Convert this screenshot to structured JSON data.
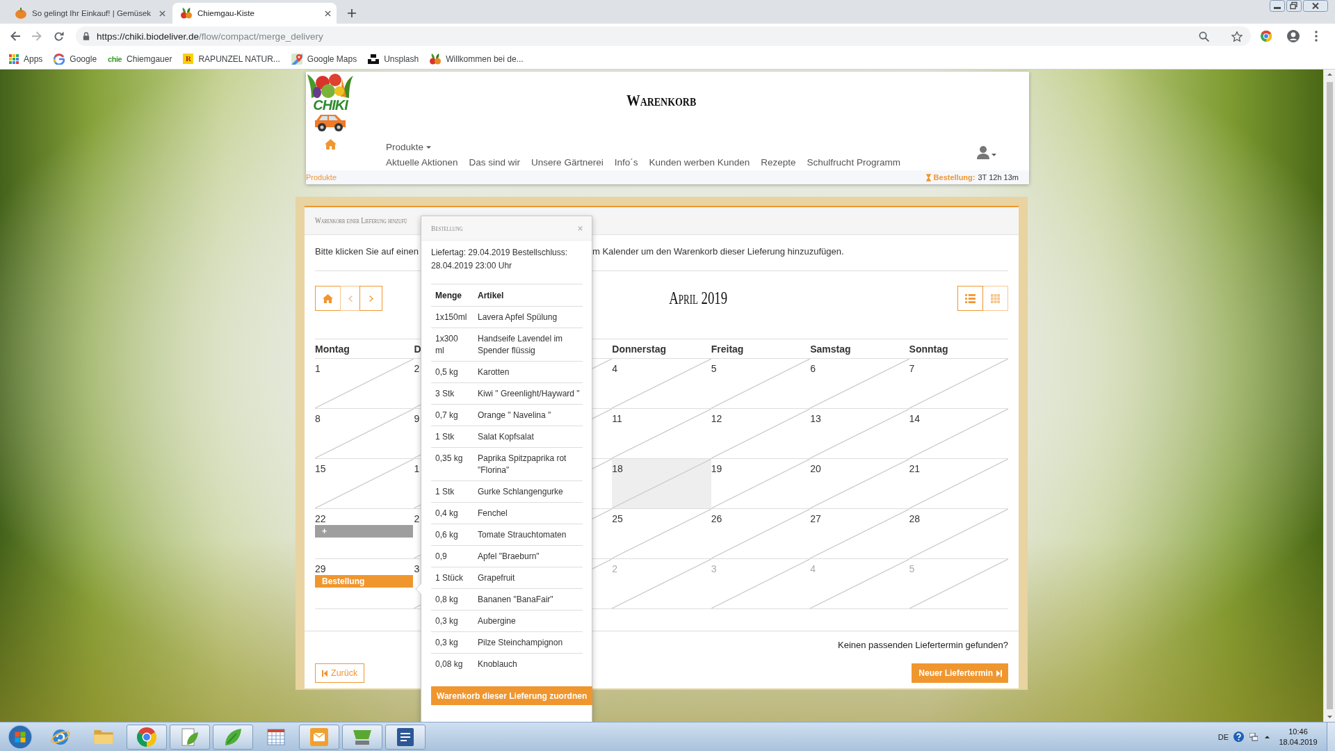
{
  "window": {
    "controls": [
      {
        "kind": "minimize"
      },
      {
        "kind": "restore"
      },
      {
        "kind": "close"
      }
    ]
  },
  "browser": {
    "tabs": [
      {
        "kind": "pumpkin",
        "title": "So gelingt Ihr Einkauf! | Gemüsek",
        "selected": false
      },
      {
        "kind": "vegetables",
        "title": "Chiemgau-Kiste",
        "selected": true
      }
    ],
    "url": {
      "origin": "https://chiki.biodeliver.de",
      "path": "/flow/compact/merge_delivery"
    },
    "bookmarks": [
      {
        "kind": "apps",
        "label": "Apps"
      },
      {
        "kind": "ring",
        "label": "Google"
      },
      {
        "kind": "text",
        "badge": "chie",
        "label": "Chiemgauer"
      },
      {
        "kind": "tile",
        "badge": "R",
        "label": "RAPUNZEL NATUR..."
      },
      {
        "kind": "pin",
        "label": "Google Maps"
      },
      {
        "kind": "blocks",
        "label": "Unsplash"
      },
      {
        "kind": "vegetables",
        "label": "Willkommen bei de..."
      }
    ]
  },
  "header": {
    "logo_text": "CHIKI",
    "title": "Warenkorb",
    "menu": "Produkte",
    "links": [
      "Aktuelle Aktionen",
      "Das sind wir",
      "Unsere Gärtnerei",
      "Info´s",
      "Kunden werben Kunden",
      "Rezepte",
      "Schulfrucht Programm"
    ],
    "breadcrumb": "Produkte",
    "timer": {
      "label": "Bestellung:",
      "value": "3T 12h 13m"
    }
  },
  "panel": {
    "heading": "Warenkorb einer Lieferung hinzufü",
    "instruction": [
      "Bitte klicken Sie auf einen",
      "m Kalender um den Warenkorb dieser Lieferung hinzuzufügen."
    ],
    "calendar": {
      "title": "April 2019",
      "nav": [
        {
          "kind": "home"
        },
        {
          "kind": "prev"
        },
        {
          "kind": "next"
        }
      ],
      "views": [
        {
          "kind": "list",
          "selected": true
        },
        {
          "kind": "grid",
          "selected": false
        }
      ],
      "columns": [
        {
          "weekday": "Montag",
          "days": [
            {
              "day": "1",
              "disabled": true,
              "muted": false,
              "today": false
            },
            {
              "day": "8",
              "disabled": true,
              "muted": false,
              "today": false
            },
            {
              "day": "15",
              "disabled": true,
              "muted": false,
              "today": false
            },
            {
              "day": "22",
              "disabled": false,
              "muted": false,
              "today": false,
              "event": {
                "kind": "add",
                "label": "+"
              }
            },
            {
              "day": "29",
              "disabled": false,
              "muted": false,
              "today": false,
              "event": {
                "kind": "order",
                "label": "Bestellung"
              }
            }
          ]
        },
        {
          "weekday": "D",
          "days": [
            {
              "day": "2",
              "disabled": true,
              "muted": false,
              "today": false
            },
            {
              "day": "9",
              "disabled": true,
              "muted": false,
              "today": false
            },
            {
              "day": "1",
              "disabled": true,
              "muted": false,
              "today": false
            },
            {
              "day": "2",
              "disabled": true,
              "muted": false,
              "today": false
            },
            {
              "day": "3",
              "disabled": true,
              "muted": false,
              "today": false
            }
          ]
        },
        {
          "days": [
            {
              "disabled": true
            },
            {
              "disabled": true
            },
            {
              "disabled": true
            },
            {
              "disabled": true
            },
            {
              "disabled": true
            }
          ]
        },
        {
          "weekday": "Donnerstag",
          "days": [
            {
              "day": "4",
              "disabled": true,
              "muted": false,
              "today": false
            },
            {
              "day": "11",
              "disabled": true,
              "muted": false,
              "today": false
            },
            {
              "day": "18",
              "disabled": true,
              "muted": false,
              "today": true
            },
            {
              "day": "25",
              "disabled": true,
              "muted": false,
              "today": false
            },
            {
              "day": "2",
              "disabled": true,
              "muted": true,
              "today": false
            }
          ]
        },
        {
          "weekday": "Freitag",
          "days": [
            {
              "day": "5",
              "disabled": true,
              "muted": false,
              "today": false
            },
            {
              "day": "12",
              "disabled": true,
              "muted": false,
              "today": false
            },
            {
              "day": "19",
              "disabled": true,
              "muted": false,
              "today": false
            },
            {
              "day": "26",
              "disabled": true,
              "muted": false,
              "today": false
            },
            {
              "day": "3",
              "disabled": true,
              "muted": true,
              "today": false
            }
          ]
        },
        {
          "weekday": "Samstag",
          "days": [
            {
              "day": "6",
              "disabled": true,
              "muted": false,
              "today": false
            },
            {
              "day": "13",
              "disabled": true,
              "muted": false,
              "today": false
            },
            {
              "day": "20",
              "disabled": true,
              "muted": false,
              "today": false
            },
            {
              "day": "27",
              "disabled": true,
              "muted": false,
              "today": false
            },
            {
              "day": "4",
              "disabled": true,
              "muted": true,
              "today": false
            }
          ]
        },
        {
          "weekday": "Sonntag",
          "days": [
            {
              "day": "7",
              "disabled": true,
              "muted": false,
              "today": false
            },
            {
              "day": "14",
              "disabled": true,
              "muted": false,
              "today": false
            },
            {
              "day": "21",
              "disabled": true,
              "muted": false,
              "today": false
            },
            {
              "day": "28",
              "disabled": true,
              "muted": false,
              "today": false
            },
            {
              "day": "5",
              "disabled": true,
              "muted": true,
              "today": false
            }
          ]
        }
      ]
    },
    "question": "Keinen passenden Liefertermin gefunden?",
    "back_button": "Zurück",
    "new_button": "Neuer Liefertermin"
  },
  "popover": {
    "title": "Bestellung",
    "info": "Liefertag: 29.04.2019 Bestellschluss: 28.04.2019 23:00 Uhr",
    "columns": [
      "Menge",
      "Artikel"
    ],
    "rows": [
      [
        "1x150ml",
        "Lavera Apfel Spülung"
      ],
      [
        "1x300 ml",
        "Handseife Lavendel im Spender flüssig"
      ],
      [
        "0,5 kg",
        "Karotten"
      ],
      [
        "3 Stk",
        "Kiwi \" Greenlight/Hayward \""
      ],
      [
        "0,7 kg",
        "Orange \" Navelina \""
      ],
      [
        "1 Stk",
        "Salat Kopfsalat"
      ],
      [
        "0,35 kg",
        "Paprika Spitzpaprika rot \"Florina\""
      ],
      [
        "1 Stk",
        "Gurke Schlangengurke"
      ],
      [
        "0,4 kg",
        "Fenchel"
      ],
      [
        "0,6 kg",
        "Tomate Strauchtomaten"
      ],
      [
        "0,9",
        "Apfel \"Braeburn\""
      ],
      [
        "1 Stück",
        "Grapefruit"
      ],
      [
        "0,8 kg",
        "Bananen \"BanaFair\""
      ],
      [
        "0,3 kg",
        "Aubergine"
      ],
      [
        "0,3 kg",
        "Pilze Steinchampignon"
      ],
      [
        "0,08 kg",
        "Knoblauch"
      ]
    ],
    "button": "Warenkorb dieser Lieferung zuordnen"
  },
  "taskbar": {
    "apps": [
      {
        "kind": "globe",
        "running": false
      },
      {
        "kind": "folder",
        "running": false
      },
      {
        "kind": "wheel",
        "running": true
      },
      {
        "kind": "leafdoc",
        "running": true
      },
      {
        "kind": "leaf",
        "running": true
      },
      {
        "kind": "grid",
        "running": false
      },
      {
        "kind": "mail",
        "running": true
      },
      {
        "kind": "basket",
        "running": true
      },
      {
        "kind": "document",
        "running": true
      }
    ],
    "tray": {
      "language": "DE",
      "time": "10:46",
      "date": "18.04.2019"
    }
  }
}
